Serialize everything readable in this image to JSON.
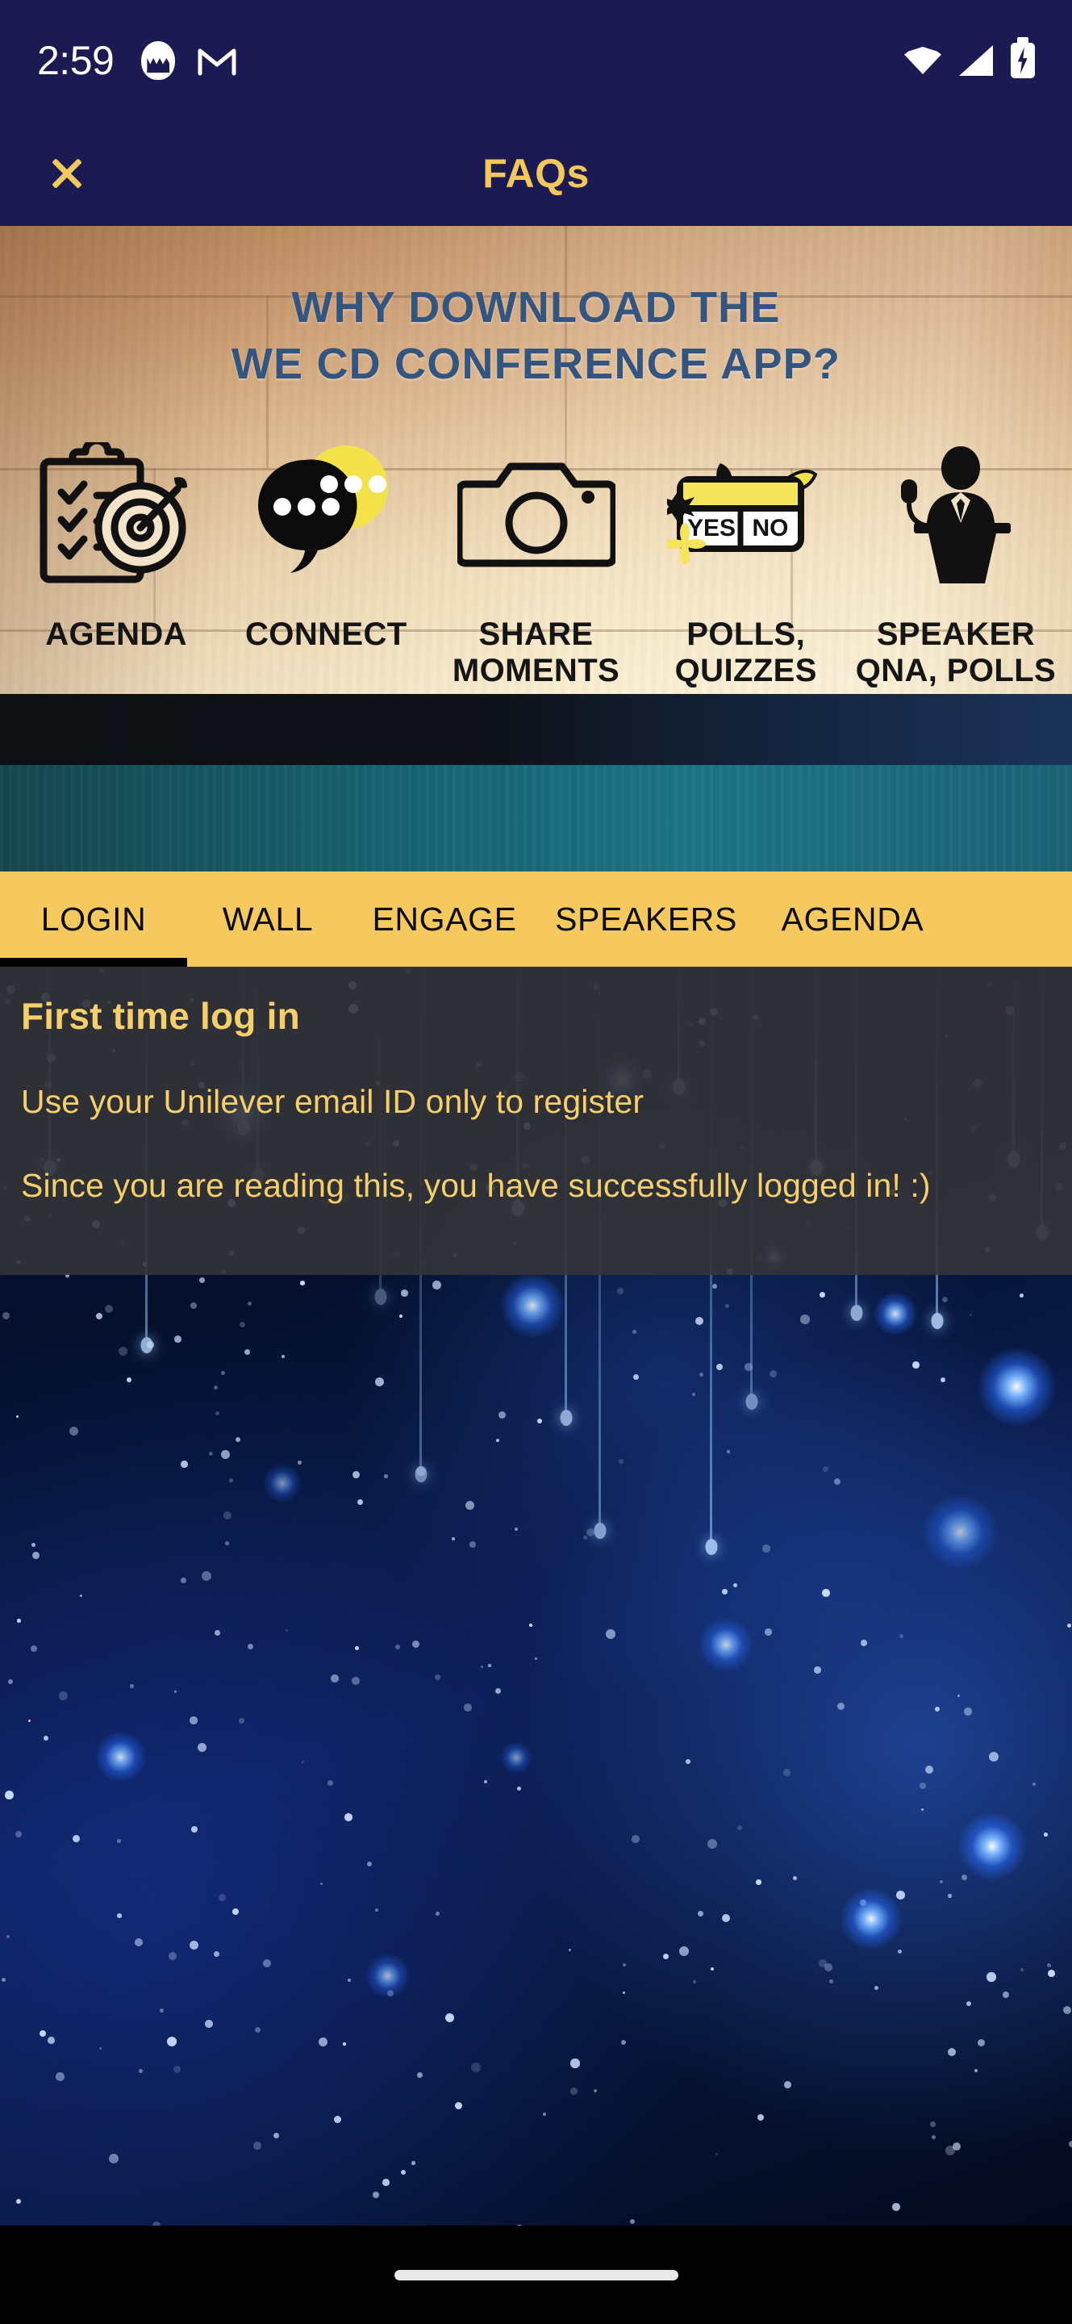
{
  "status_bar": {
    "time": "2:59",
    "app_icons": [
      {
        "name": "egg-app-icon",
        "label": "egg"
      },
      {
        "name": "gmail-icon",
        "label": "M"
      }
    ],
    "system_icons": [
      {
        "name": "wifi-icon",
        "label": "wifi"
      },
      {
        "name": "cellular-signal-icon",
        "label": "signal"
      },
      {
        "name": "battery-charging-icon",
        "label": "battery charging"
      }
    ]
  },
  "header": {
    "title": "FAQs",
    "close_label": "✕",
    "background_color": "#1C1A52",
    "accent_color": "#F2C75C"
  },
  "banner": {
    "headline_line1": "WHY DOWNLOAD THE",
    "headline_line2": "WE CD CONFERENCE APP?",
    "headline_color": "#33557F",
    "features": [
      {
        "icon": "clipboard-target-icon",
        "label": "AGENDA"
      },
      {
        "icon": "speech-bubble-icon",
        "label": "CONNECT"
      },
      {
        "icon": "camera-icon",
        "label": "SHARE\nMOMENTS",
        "label_line1": "SHARE",
        "label_line2": "MOMENTS"
      },
      {
        "icon": "yes-no-poll-icon",
        "label": "POLLS,\nQUIZZES",
        "label_line1": "POLLS,",
        "label_line2": "QUIZZES",
        "option_yes": "YES",
        "option_no": "NO"
      },
      {
        "icon": "speaker-podium-icon",
        "label": "SPEAKER\nQNA, POLLS",
        "label_line1": "SPEAKER",
        "label_line2": "QNA, POLLS"
      }
    ]
  },
  "tabs": {
    "active": "LOGIN",
    "accent_color": "#F5C95E",
    "items": [
      {
        "label": "LOGIN",
        "active": true
      },
      {
        "label": "WALL",
        "active": false
      },
      {
        "label": "ENGAGE",
        "active": false
      },
      {
        "label": "SPEAKERS",
        "active": false
      },
      {
        "label": "AGENDA",
        "active": false
      }
    ]
  },
  "faq": {
    "text_color": "#F5CF6B",
    "overlay_color": "rgba(52,52,55,0.90)",
    "heading": "First time log in",
    "line1": "Use your Unilever email ID only to register",
    "line2": "Since you are reading this, you have successfully logged in! :)"
  },
  "nav_bar": {
    "home_indicator": "home-indicator"
  }
}
